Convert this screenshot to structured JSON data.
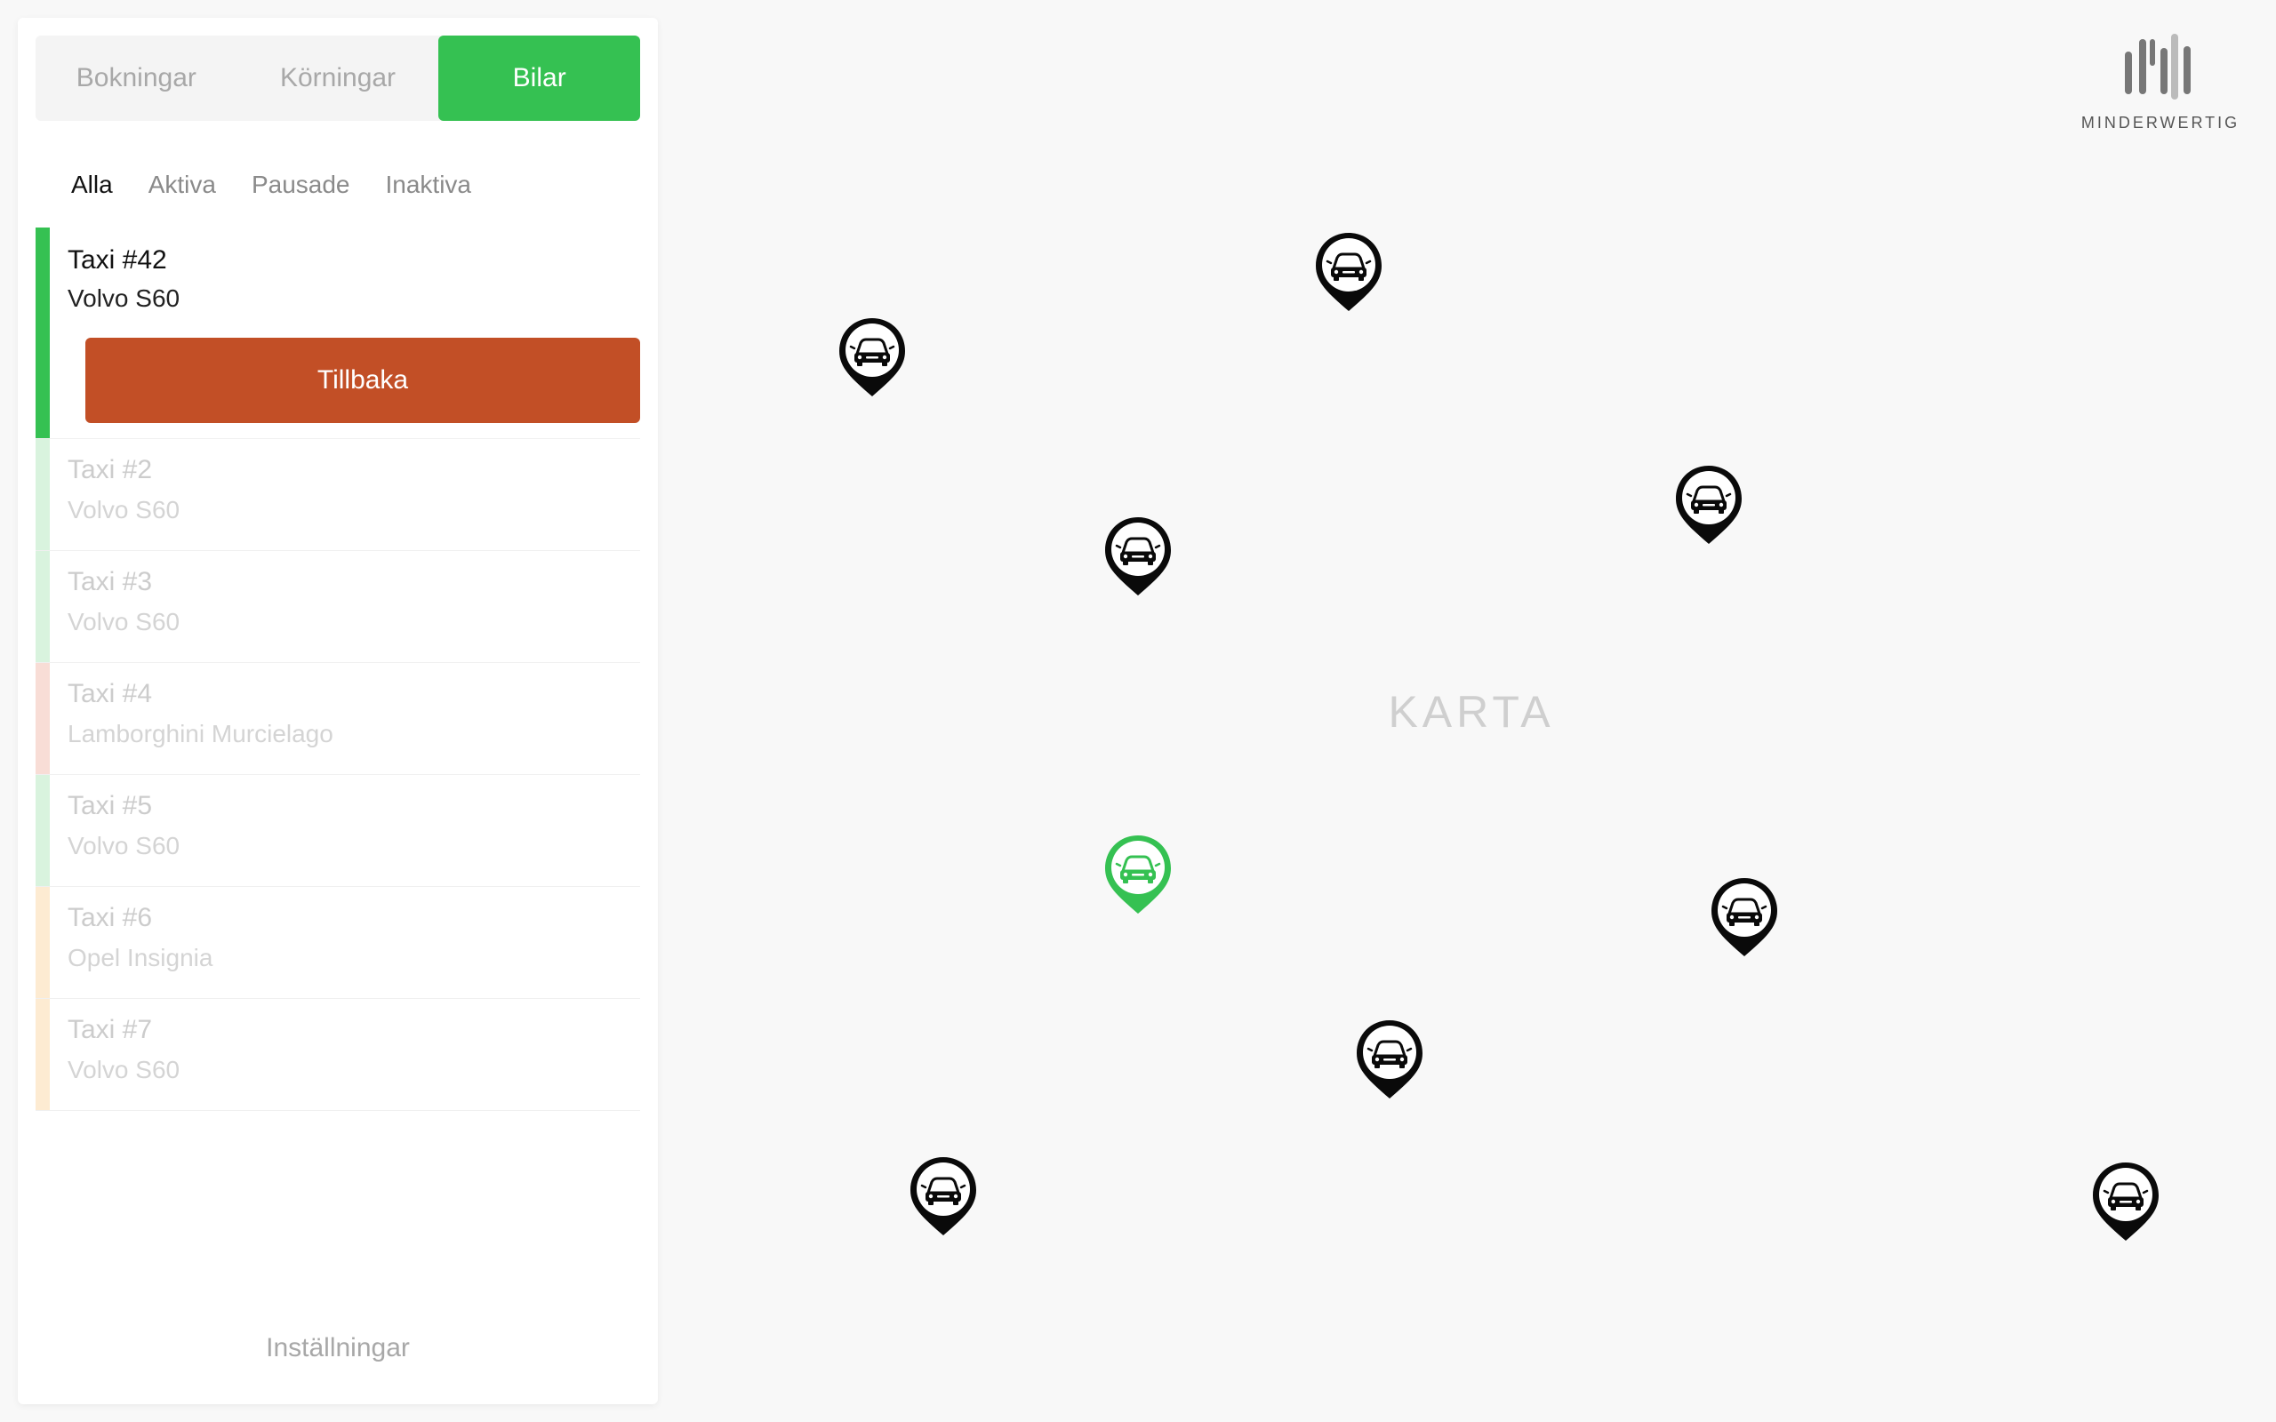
{
  "tabs": [
    {
      "label": "Bokningar",
      "active": false
    },
    {
      "label": "Körningar",
      "active": false
    },
    {
      "label": "Bilar",
      "active": true
    }
  ],
  "filters": [
    {
      "label": "Alla",
      "active": true
    },
    {
      "label": "Aktiva",
      "active": false
    },
    {
      "label": "Pausade",
      "active": false
    },
    {
      "label": "Inaktiva",
      "active": false
    }
  ],
  "selected_car": {
    "name": "Taxi #42",
    "model": "Volvo S60",
    "status_color": "#35c152",
    "back_label": "Tillbaka"
  },
  "cars": [
    {
      "name": "Taxi #2",
      "model": "Volvo S60",
      "status_color": "#d9f3de"
    },
    {
      "name": "Taxi #3",
      "model": "Volvo S60",
      "status_color": "#d9f3de"
    },
    {
      "name": "Taxi #4",
      "model": "Lamborghini Murcielago",
      "status_color": "#f8ddd6"
    },
    {
      "name": "Taxi #5",
      "model": "Volvo S60",
      "status_color": "#d9f3de"
    },
    {
      "name": "Taxi #6",
      "model": "Opel Insignia",
      "status_color": "#fdebd2"
    },
    {
      "name": "Taxi #7",
      "model": "Volvo S60",
      "status_color": "#fdebd2"
    }
  ],
  "settings_label": "Inställningar",
  "map": {
    "label": "KARTA",
    "pin_icon": "car-pin-icon",
    "pins_highlighted": [
      false,
      false,
      false,
      false,
      true,
      false,
      false,
      false,
      false
    ]
  },
  "logo": {
    "text": "MINDERWERTIG"
  },
  "colors": {
    "accent": "#35c152",
    "back_button": "#c24f26"
  }
}
